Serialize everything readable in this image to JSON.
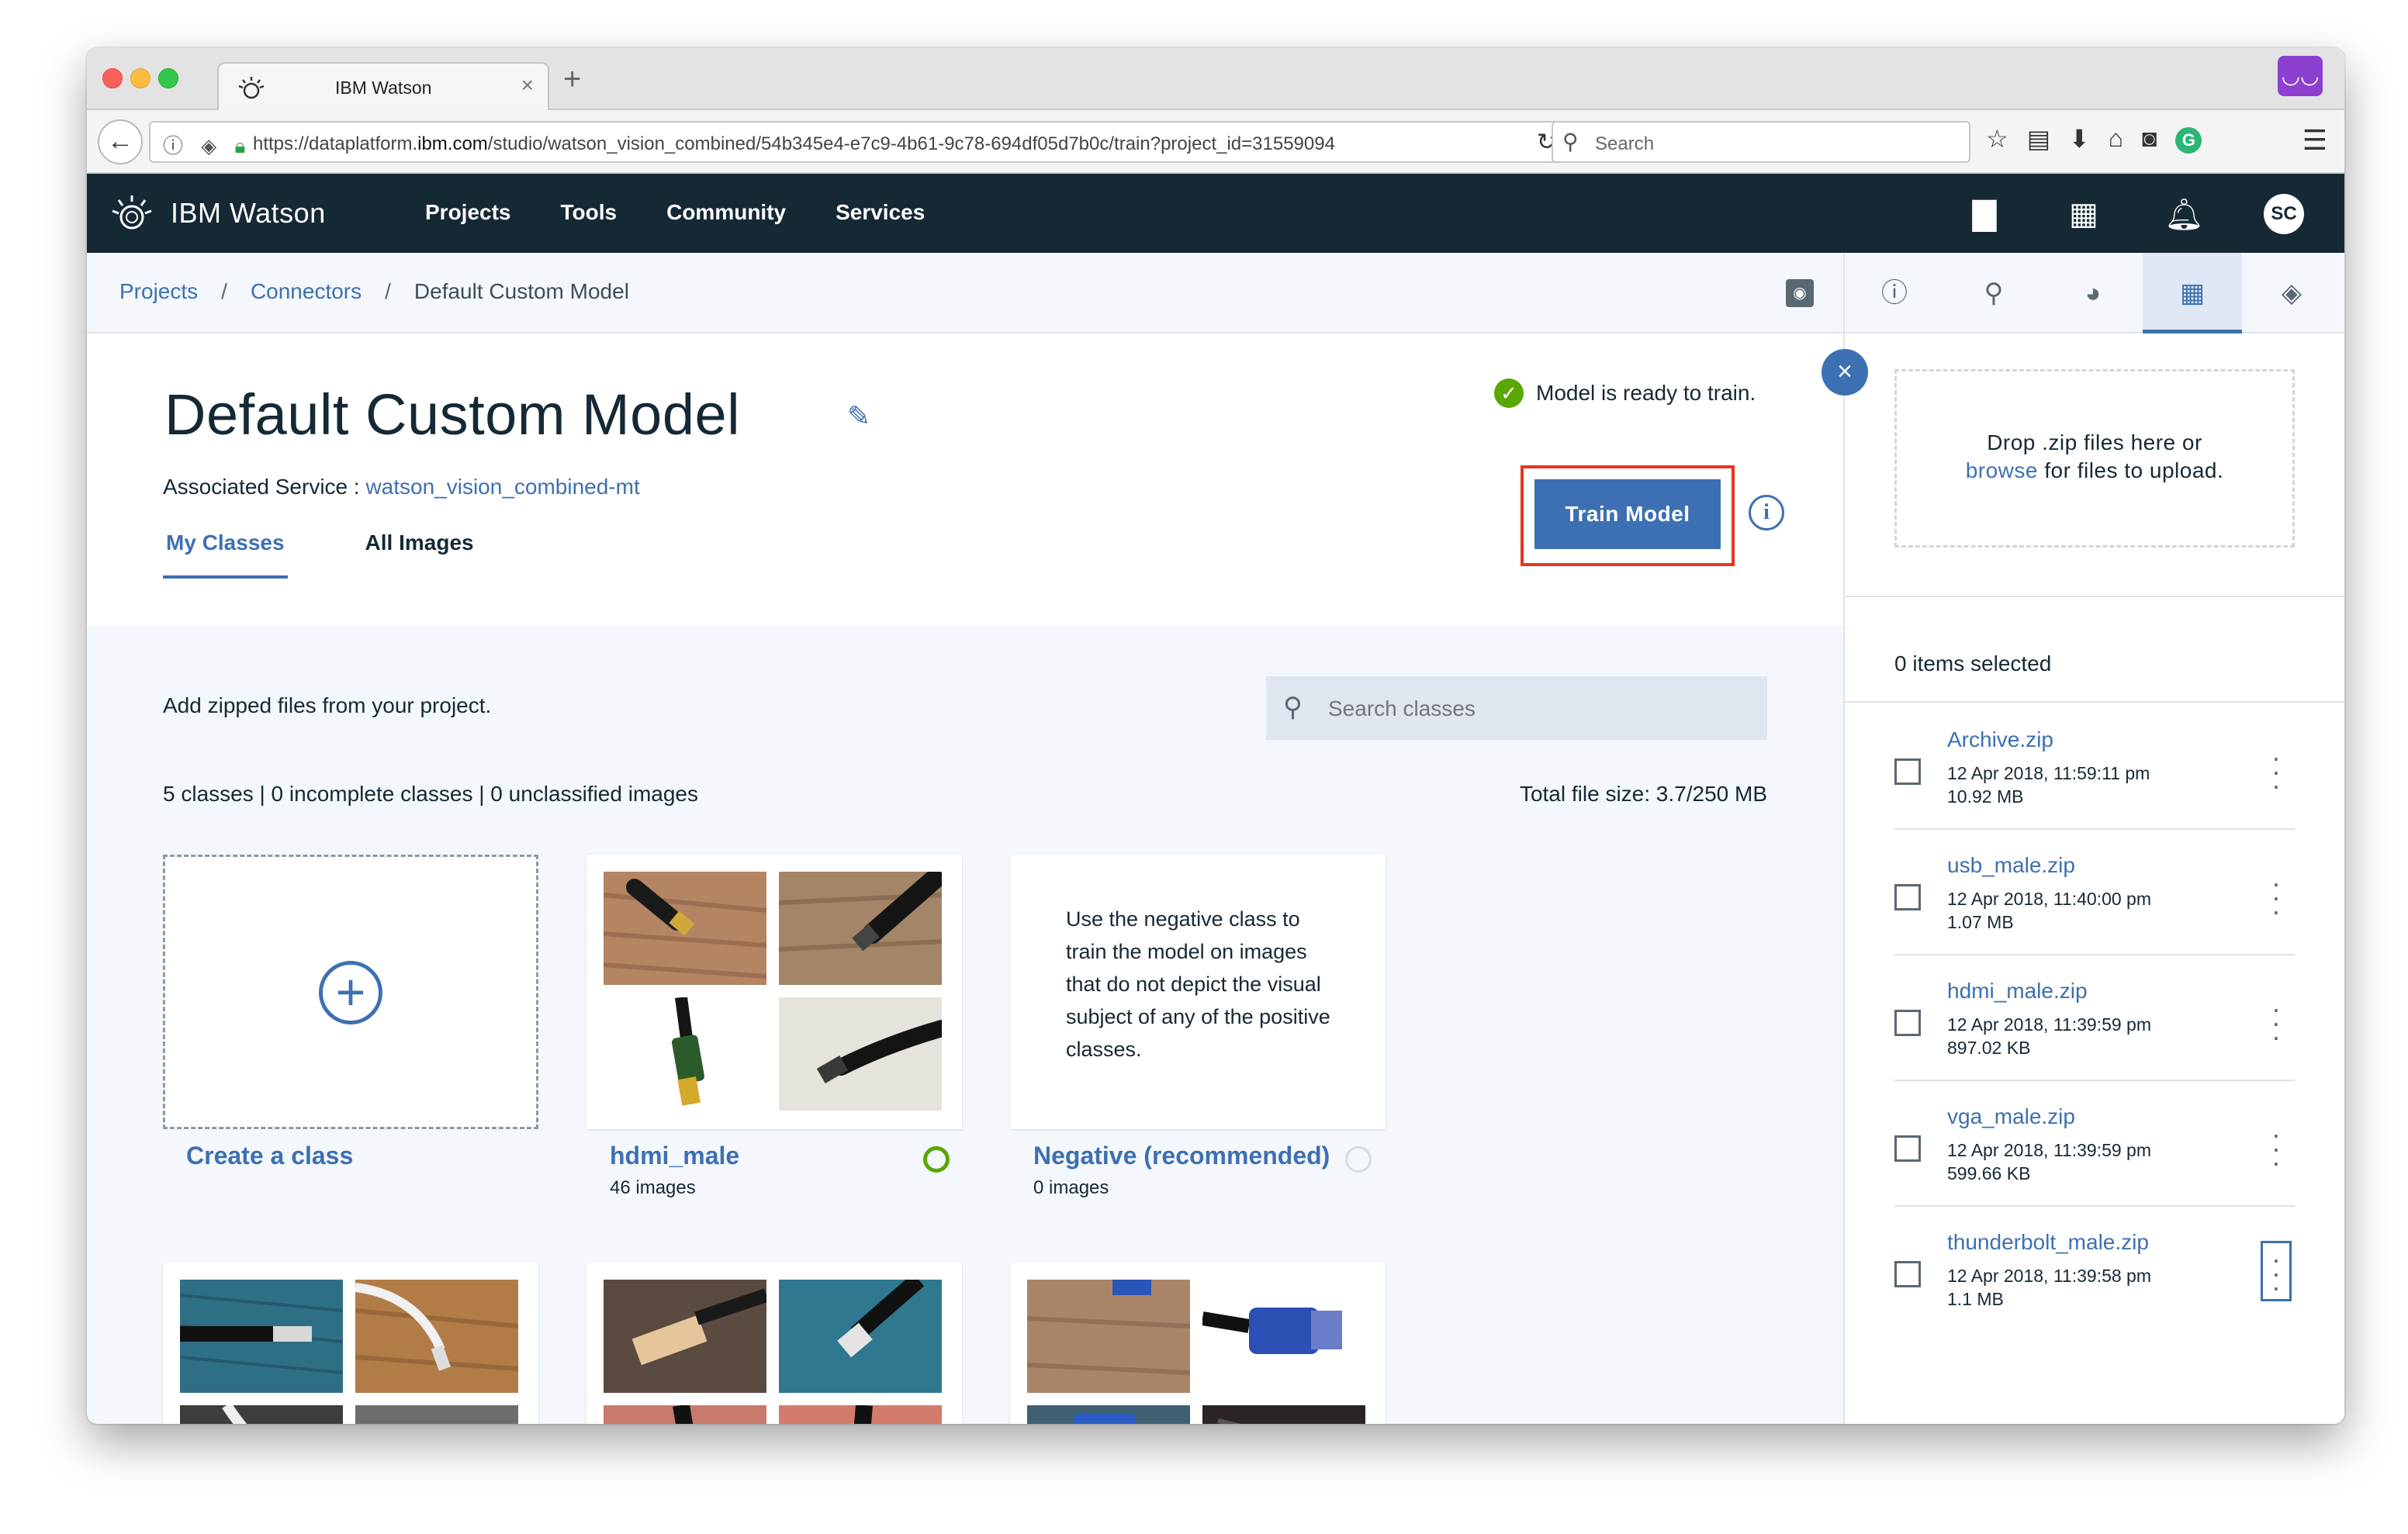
{
  "browser": {
    "tab_title": "IBM Watson",
    "tab_close": "×",
    "new_tab": "+",
    "url_prefix": "https://dataplatform.",
    "url_host": "ibm.com",
    "url_rest": "/studio/watson_vision_combined/54b345e4-e7c9-4b61-9c78-694df05d7b0c/train?project_id=31559094",
    "search_placeholder": "Search"
  },
  "app": {
    "brand": "IBM Watson",
    "nav": [
      "Projects",
      "Tools",
      "Community",
      "Services"
    ],
    "avatar": "SC"
  },
  "breadcrumb": {
    "items": [
      "Projects",
      "Connectors",
      "Default Custom Model"
    ],
    "sep": "/"
  },
  "model": {
    "title": "Default Custom Model",
    "assoc_label": "Associated Service : ",
    "assoc_service": "watson_vision_combined-mt",
    "ready_text": "Model is ready to train.",
    "train_button": "Train Model",
    "info_glyph": "i",
    "tabs": [
      "My Classes",
      "All Images"
    ]
  },
  "classes": {
    "add_zipped": "Add zipped files from your project.",
    "search_placeholder": "Search classes",
    "stats": "5 classes | 0 incomplete classes | 0 unclassified images",
    "filesize": "Total file size: 3.7/250 MB",
    "create_label": "Create a class",
    "hdmi_name": "hdmi_male",
    "hdmi_count": "46 images",
    "negative_name": "Negative (recommended)",
    "negative_count": "0 images",
    "negative_text": "Use the negative class to train the model on images that do not depict the visual subject of any of the positive classes."
  },
  "panel": {
    "drop_line1": "Drop .zip files here or",
    "drop_browse": "browse",
    "drop_line2_rest": " for files to upload.",
    "selected": "0 items selected",
    "files": [
      {
        "name": "Archive.zip",
        "date": "12 Apr 2018, 11:59:11 pm",
        "size": "10.92 MB"
      },
      {
        "name": "usb_male.zip",
        "date": "12 Apr 2018, 11:40:00 pm",
        "size": "1.07 MB"
      },
      {
        "name": "hdmi_male.zip",
        "date": "12 Apr 2018, 11:39:59 pm",
        "size": "897.02 KB"
      },
      {
        "name": "vga_male.zip",
        "date": "12 Apr 2018, 11:39:59 pm",
        "size": "599.66 KB"
      },
      {
        "name": "thunderbolt_male.zip",
        "date": "12 Apr 2018, 11:39:58 pm",
        "size": "1.1 MB"
      }
    ]
  },
  "icons": {
    "back": "arrow-left-icon",
    "reload": "reload-icon",
    "close": "close-icon",
    "edit": "pencil-icon",
    "check": "checkmark-icon",
    "plus": "plus-icon",
    "kebab": "overflow-menu-icon"
  },
  "colors": {
    "header_bg": "#152935",
    "accent": "#3d70b2",
    "ready_green": "#5aa700",
    "highlight_red": "#e8361e"
  }
}
